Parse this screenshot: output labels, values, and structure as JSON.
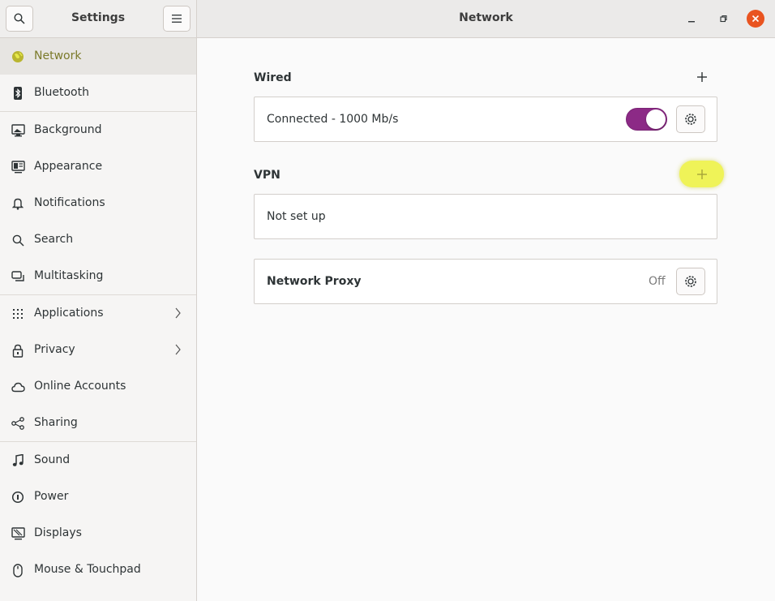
{
  "sidebar": {
    "title": "Settings",
    "items": [
      {
        "label": "Network",
        "icon": "network-icon"
      },
      {
        "label": "Bluetooth",
        "icon": "bluetooth-icon"
      },
      {
        "label": "Background",
        "icon": "background-icon"
      },
      {
        "label": "Appearance",
        "icon": "appearance-icon"
      },
      {
        "label": "Notifications",
        "icon": "bell-icon"
      },
      {
        "label": "Search",
        "icon": "search-icon"
      },
      {
        "label": "Multitasking",
        "icon": "multitasking-icon"
      },
      {
        "label": "Applications",
        "icon": "grid-icon"
      },
      {
        "label": "Privacy",
        "icon": "lock-icon"
      },
      {
        "label": "Online Accounts",
        "icon": "cloud-icon"
      },
      {
        "label": "Sharing",
        "icon": "share-icon"
      },
      {
        "label": "Sound",
        "icon": "music-note-icon"
      },
      {
        "label": "Power",
        "icon": "power-icon"
      },
      {
        "label": "Displays",
        "icon": "display-icon"
      },
      {
        "label": "Mouse & Touchpad",
        "icon": "mouse-icon"
      }
    ],
    "active": "Network"
  },
  "header": {
    "title": "Network"
  },
  "wired": {
    "title": "Wired",
    "status": "Connected - 1000 Mb/s",
    "toggle_on": true
  },
  "vpn": {
    "title": "VPN",
    "status": "Not set up"
  },
  "proxy": {
    "title": "Network Proxy",
    "status": "Off"
  },
  "colors": {
    "accent": "#8c2a86",
    "close": "#e95420",
    "highlight": "#eef23c"
  }
}
